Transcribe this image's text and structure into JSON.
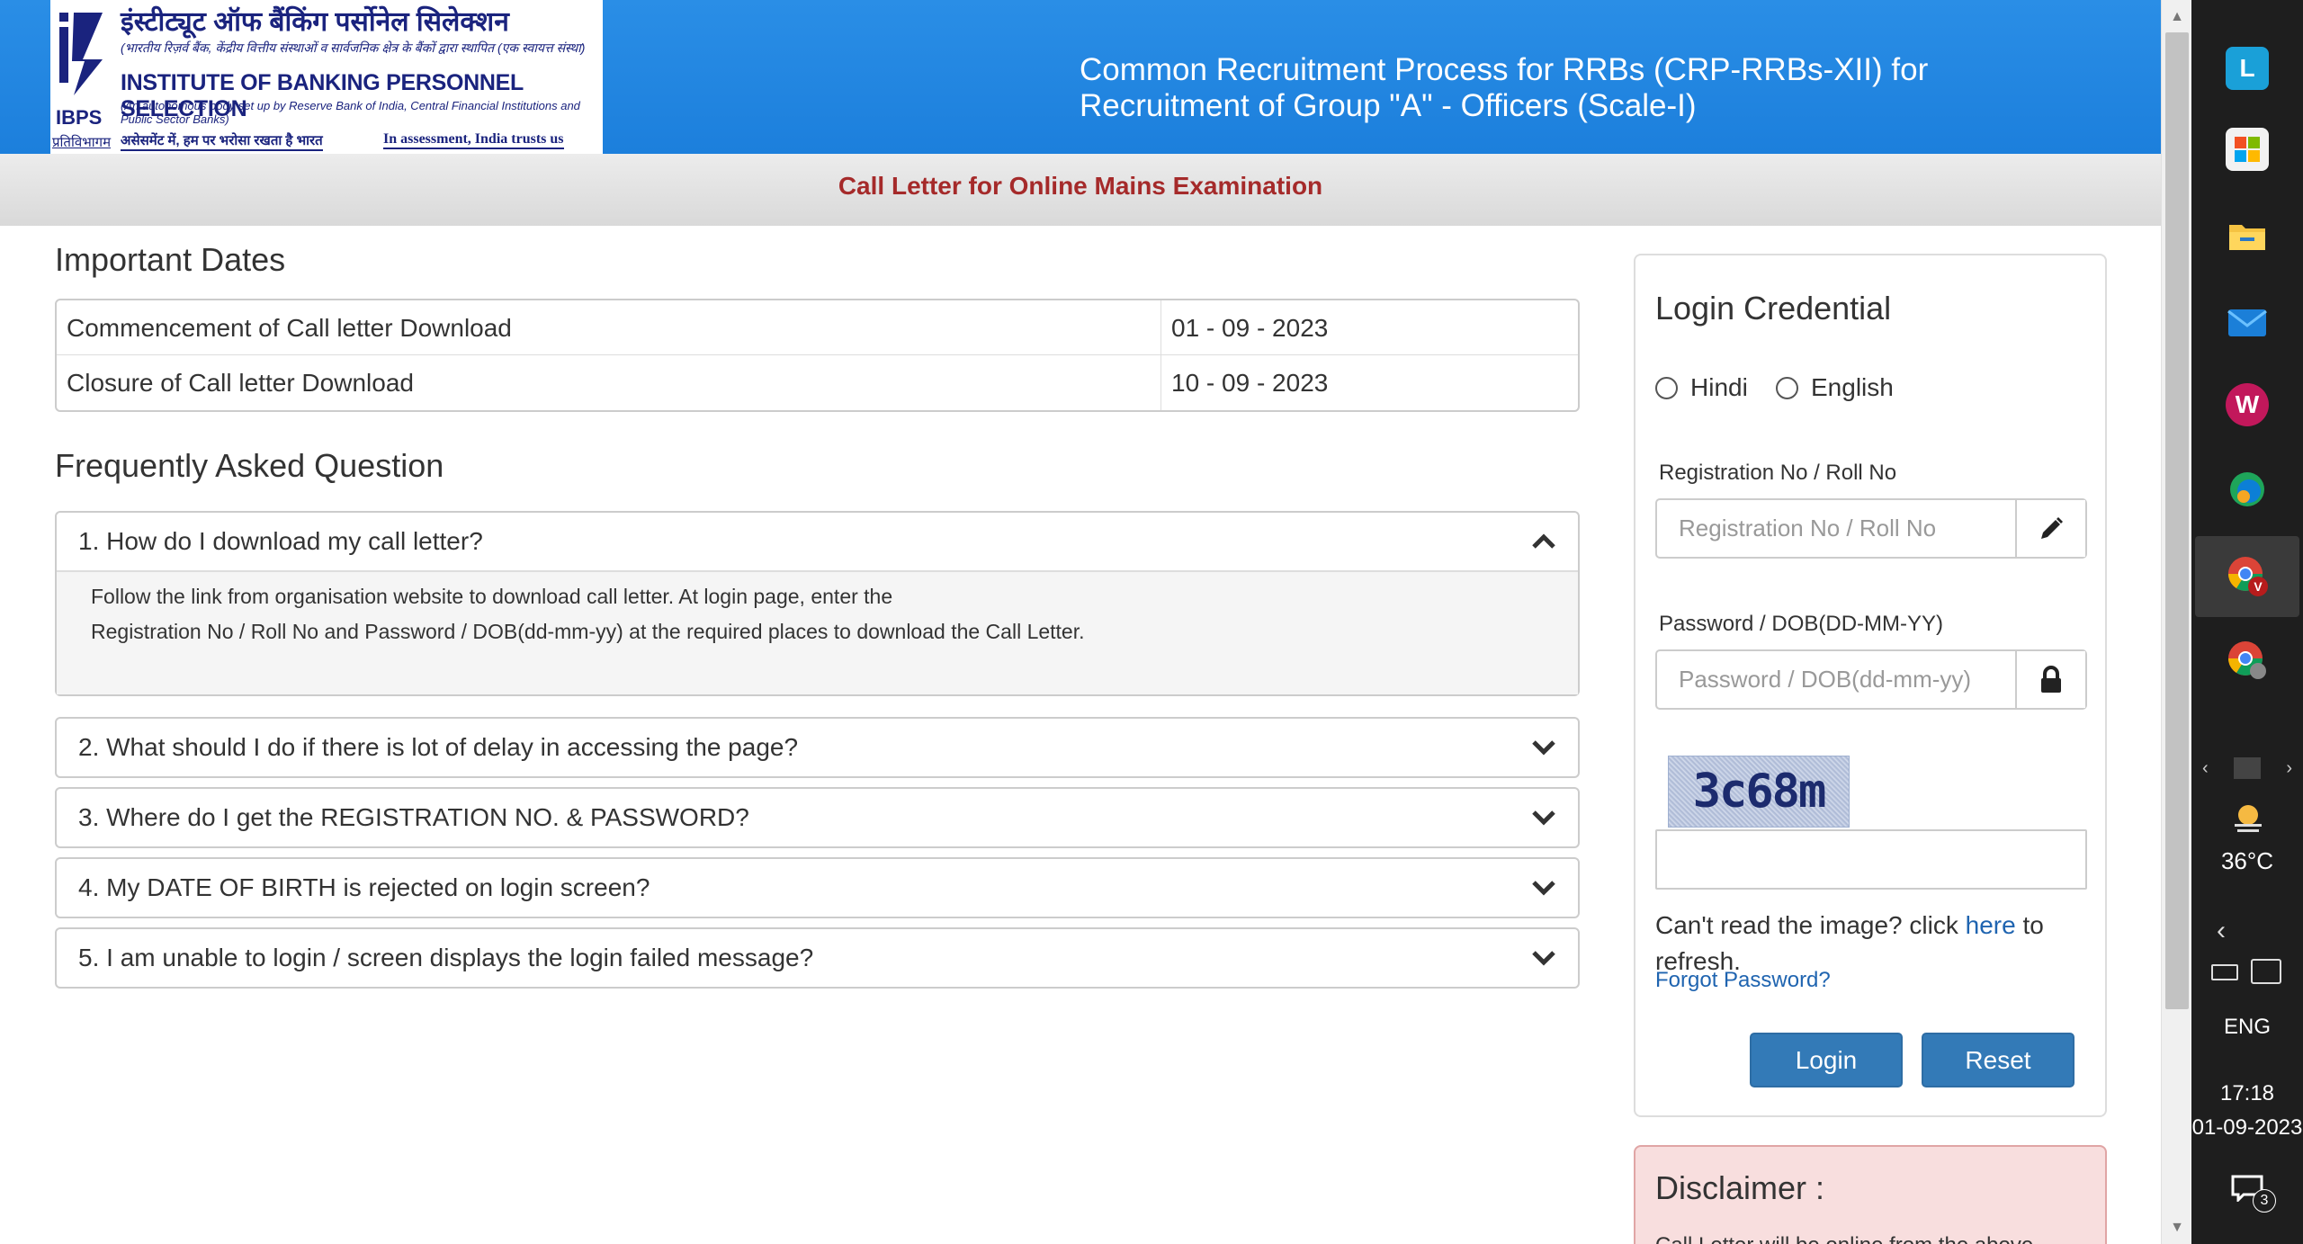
{
  "header": {
    "logo": {
      "hindi_name": "इंस्टीट्यूट ऑफ बैंकिंग पर्सोनेल सिलेक्शन",
      "hindi_subtitle": "(भारतीय रिज़र्व बैंक, केंद्रीय वित्तीय संस्थाओं व सार्वजनिक क्षेत्र के बैंकों द्वारा स्थापित (एक स्वायत्त संस्था)",
      "english_name": "INSTITUTE OF BANKING PERSONNEL SELECTION",
      "autonomous_note": "(An autonomous body set up by Reserve Bank of India, Central Financial Institutions and Public Sector Banks)",
      "mark_text": "IBPS",
      "mark_subtext": "प्रतिविभागम",
      "tagline_hindi": "असेसमेंट में, हम पर भरोसा रखता है भारत",
      "tagline_english": "In assessment, India trusts us"
    },
    "title_line1": "Common Recruitment Process for RRBs (CRP-RRBs-XII) for",
    "title_line2": "Recruitment of Group \"A\" - Officers (Scale-I)"
  },
  "subheader": {
    "title": "Call Letter for Online Mains Examination"
  },
  "important_dates": {
    "heading": "Important Dates",
    "rows": [
      {
        "label": "Commencement of Call letter Download",
        "value": "01 - 09 - 2023"
      },
      {
        "label": "Closure of Call letter Download",
        "value": "10 - 09 - 2023"
      }
    ]
  },
  "faq": {
    "heading": "Frequently Asked Question",
    "items": [
      {
        "question": "1. How do I download my call letter?",
        "expanded": true,
        "answer_line1": "Follow the link from organisation website to download call letter. At login page, enter the",
        "answer_line2": "Registration No / Roll No and Password / DOB(dd-mm-yy) at the required places to download the Call Letter."
      },
      {
        "question": "2. What should I do if there is lot of delay in accessing the page?",
        "expanded": false
      },
      {
        "question": "3. Where do I get the REGISTRATION NO. & PASSWORD?",
        "expanded": false
      },
      {
        "question": "4. My DATE OF BIRTH is rejected on login screen?",
        "expanded": false
      },
      {
        "question": "5. I am unable to login / screen displays the login failed message?",
        "expanded": false
      }
    ]
  },
  "login": {
    "heading": "Login Credential",
    "languages": [
      "Hindi",
      "English"
    ],
    "registration_label": "Registration No / Roll No",
    "registration_placeholder": "Registration No / Roll No",
    "registration_icon": "pencil-icon",
    "password_label": "Password / DOB(DD-MM-YY)",
    "password_placeholder": "Password / DOB(dd-mm-yy)",
    "password_icon": "lock-icon",
    "captcha_text": "3c68m",
    "captcha_help_prefix": "Can't read the image? click",
    "captcha_help_link": "here",
    "captcha_help_suffix": "to refresh.",
    "forgot_password": "Forgot Password?",
    "login_button": "Login",
    "reset_button": "Reset"
  },
  "disclaimer": {
    "heading": "Disclaimer :",
    "text": "Call Letter will be online from the above"
  },
  "taskbar": {
    "apps": [
      "L",
      "store-icon",
      "folder-icon",
      "mail-icon",
      "w-icon",
      "edge-icon",
      "chrome-v-icon",
      "chrome-icon"
    ],
    "temperature": "36°C",
    "language": "ENG",
    "time": "17:18",
    "date": "01-09-2023",
    "notification_count": "3"
  },
  "colors": {
    "header_blue": "#1c7fdc",
    "subheader_red": "#a52a2a",
    "button_blue": "#337ab7",
    "link_blue": "#1f64b0",
    "disclaimer_bg": "#f8dede"
  }
}
